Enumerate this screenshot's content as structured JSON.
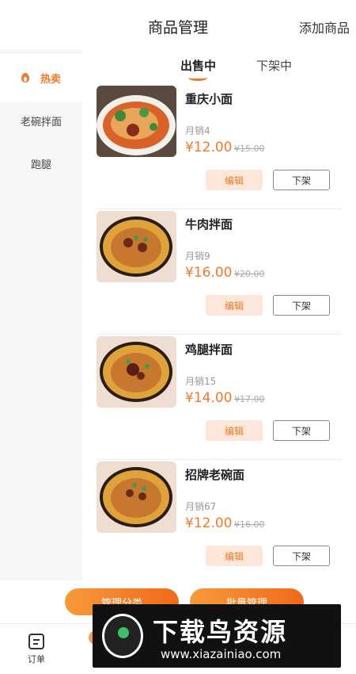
{
  "header": {
    "title": "商品管理",
    "add_button": "添加商品"
  },
  "sidebar": {
    "items": [
      {
        "label": "热卖",
        "active": true
      },
      {
        "label": "老碗拌面",
        "active": false
      },
      {
        "label": "跑腿",
        "active": false
      }
    ]
  },
  "tabs": [
    {
      "label": "出售中",
      "active": true
    },
    {
      "label": "下架中",
      "active": false
    }
  ],
  "products": [
    {
      "name": "重庆小面",
      "sales": "月销4",
      "price": "¥12.00",
      "old_price": "¥15.00",
      "edit": "编辑",
      "off_shelf": "下架"
    },
    {
      "name": "牛肉拌面",
      "sales": "月销9",
      "price": "¥16.00",
      "old_price": "¥20.00",
      "edit": "编辑",
      "off_shelf": "下架"
    },
    {
      "name": "鸡腿拌面",
      "sales": "月销15",
      "price": "¥14.00",
      "old_price": "¥17.00",
      "edit": "编辑",
      "off_shelf": "下架"
    },
    {
      "name": "招牌老碗面",
      "sales": "月销67",
      "price": "¥12.00",
      "old_price": "¥16.00",
      "edit": "编辑",
      "off_shelf": "下架"
    }
  ],
  "bottom_actions": {
    "manage_category": "管理分类",
    "batch_manage": "批量管理"
  },
  "tabbar": {
    "orders": "订单"
  },
  "watermark": {
    "title": "下载鸟资源",
    "url": "www.xiazainiao.com"
  },
  "colors": {
    "accent": "#f07a2a",
    "edit_bg": "#fde6da"
  }
}
